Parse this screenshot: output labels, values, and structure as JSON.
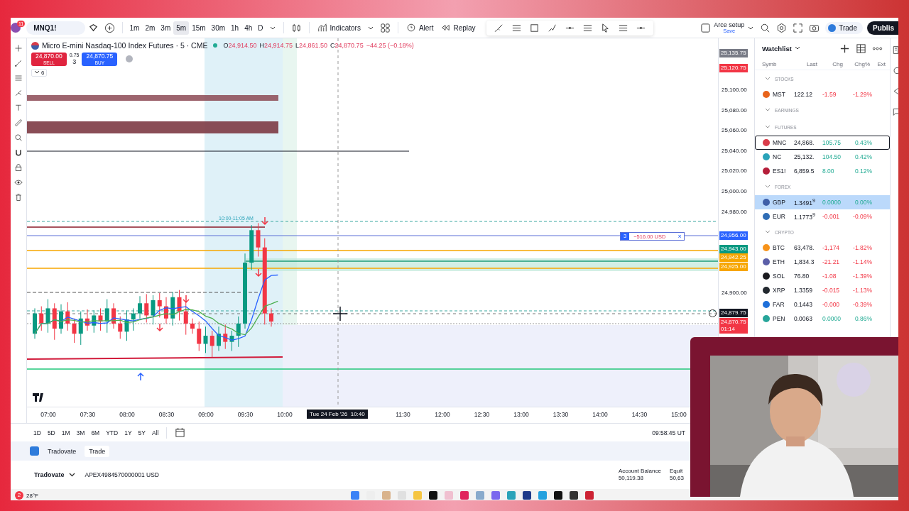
{
  "top_toolbar": {
    "notification_badge": "11",
    "symbol": "MNQ1!",
    "intervals": [
      {
        "label": "1m",
        "selected": false
      },
      {
        "label": "2m",
        "selected": false
      },
      {
        "label": "3m",
        "selected": false
      },
      {
        "label": "5m",
        "selected": true
      },
      {
        "label": "15m",
        "selected": false
      },
      {
        "label": "30m",
        "selected": false
      },
      {
        "label": "1h",
        "selected": false
      },
      {
        "label": "4h",
        "selected": false
      },
      {
        "label": "D",
        "selected": false
      }
    ],
    "indicators": "Indicators",
    "alert": "Alert",
    "replay": "Replay",
    "layout": {
      "name": "Arce setup",
      "status": "Save"
    },
    "trade": "Trade",
    "publish": "Publis"
  },
  "chart": {
    "title": "Micro E-mini Nasdaq-100 Index Futures · 5 · CME",
    "market_open": true,
    "ohlc": [
      {
        "label": "O",
        "value": "24,914.50"
      },
      {
        "label": "H",
        "value": "24,914.75"
      },
      {
        "label": "L",
        "value": "24,861.50"
      },
      {
        "label": "C",
        "value": "24,870.75"
      }
    ],
    "change": "−44.25 (−0.18%)",
    "sell": {
      "price": "24,870.00",
      "label": "SELL"
    },
    "spread": {
      "value": "0.75",
      "quantity": "3"
    },
    "buy": {
      "price": "24,870.75",
      "label": "BUY"
    },
    "indicators_count": "6",
    "session_label": "10:00-11:05 AM",
    "position": {
      "quantity": "3",
      "pnl": "−516.00 USD",
      "close": "×"
    },
    "price_axis": [
      {
        "kind": "badge",
        "text": "25,135.75",
        "color": "#787b86"
      },
      {
        "kind": "badge",
        "text": "25,120.75",
        "color": "#f23645"
      },
      {
        "kind": "tick",
        "text": "25,100.00"
      },
      {
        "kind": "tick",
        "text": "25,080.00"
      },
      {
        "kind": "tick",
        "text": "25,060.00"
      },
      {
        "kind": "tick",
        "text": "25,040.00"
      },
      {
        "kind": "tick",
        "text": "25,020.00"
      },
      {
        "kind": "tick",
        "text": "25,000.00"
      },
      {
        "kind": "tick",
        "text": "24,980.00"
      },
      {
        "kind": "badge",
        "text": "24,956.00",
        "color": "#2962ff"
      },
      {
        "kind": "badge",
        "text": "24,943.00",
        "color": "#089981"
      },
      {
        "kind": "badge",
        "text": "24,942.25",
        "color": "#f7a600"
      },
      {
        "kind": "badge",
        "text": "24,925.00",
        "color": "#f7a600"
      },
      {
        "kind": "tick",
        "text": "24,900.00"
      },
      {
        "kind": "badge",
        "text": "24,879.75",
        "color": "#131722"
      },
      {
        "kind": "badge",
        "text": "24,870.75",
        "color": "#f23645",
        "countdown": "01:14"
      }
    ],
    "time_axis": [
      "07:00",
      "07:30",
      "08:00",
      "08:30",
      "09:00",
      "09:30",
      "10:00",
      "11:30",
      "12:00",
      "12:30",
      "13:00",
      "13:30",
      "14:00",
      "14:30",
      "15:00"
    ],
    "cursor_time": "Tue 24 Feb '26  10:40"
  },
  "range_bar": {
    "ranges": [
      "1D",
      "5D",
      "1M",
      "3M",
      "6M",
      "YTD",
      "1Y",
      "5Y",
      "All"
    ],
    "clock": "09:58:45 UT"
  },
  "panel": {
    "tabs": [
      {
        "label": "Tradovate",
        "selected": false
      },
      {
        "label": "Trade",
        "selected": true
      }
    ],
    "account_broker": "Tradovate",
    "account": "APEX4984570000001 USD",
    "balance_label": "Account Balance",
    "balance": "50,119.38",
    "equity_label": "Equit",
    "equity": "50,63"
  },
  "watchlist": {
    "title": "Watchlist",
    "columns": [
      "Symb",
      "Last",
      "Chg",
      "Chg%",
      "Ext"
    ],
    "rows": [
      {
        "kind": "section",
        "label": "STOCKS"
      },
      {
        "kind": "symbol",
        "symbol": "MST",
        "last": "122.12",
        "chg": "-1.59",
        "pct": "-1.29%",
        "rising": false,
        "color": "#e8641b",
        "selected": false,
        "focused": false
      },
      {
        "kind": "section",
        "label": "EARNINGS"
      },
      {
        "kind": "section",
        "label": "FUTURES"
      },
      {
        "kind": "symbol",
        "symbol": "MNC",
        "last": "24,868.",
        "chg": "105.75",
        "pct": "0.43%",
        "rising": true,
        "color": "#d93c4a",
        "selected": false,
        "focused": true
      },
      {
        "kind": "symbol",
        "symbol": "NC",
        "last": "25,132.",
        "chg": "104.50",
        "pct": "0.42%",
        "rising": true,
        "color": "#2aa3b9",
        "selected": false,
        "focused": false
      },
      {
        "kind": "symbol",
        "symbol": "ES1!",
        "last": "6,859.5",
        "chg": "8.00",
        "pct": "0.12%",
        "rising": true,
        "color": "#b51e3a",
        "selected": false,
        "focused": false
      },
      {
        "kind": "section",
        "label": "FOREX"
      },
      {
        "kind": "symbol",
        "symbol": "GBP",
        "last": "1.3491$^{9}$",
        "chg": "0.0000",
        "pct": "0.00%",
        "rising": true,
        "color": "#3f5fa8",
        "selected": true,
        "focused": false
      },
      {
        "kind": "symbol",
        "symbol": "EUR",
        "last": "1.1773$^{9}$",
        "chg": "-0.001",
        "pct": "-0.09%",
        "rising": false,
        "color": "#2f6db5",
        "selected": false,
        "focused": false
      },
      {
        "kind": "section",
        "label": "CRYPTO"
      },
      {
        "kind": "symbol",
        "symbol": "BTC",
        "last": "63,478.",
        "chg": "-1,174",
        "pct": "-1.82%",
        "rising": false,
        "color": "#f7931a",
        "selected": false,
        "focused": false
      },
      {
        "kind": "symbol",
        "symbol": "ETH",
        "last": "1,834.3",
        "chg": "-21.21",
        "pct": "-1.14%",
        "rising": false,
        "color": "#5b5fa8",
        "selected": false,
        "focused": false
      },
      {
        "kind": "symbol",
        "symbol": "SOL",
        "last": "76.80",
        "chg": "-1.08",
        "pct": "-1.39%",
        "rising": false,
        "color": "#1b1b1f",
        "selected": false,
        "focused": false
      },
      {
        "kind": "symbol",
        "symbol": "XRP",
        "last": "1.3359",
        "chg": "-0.015",
        "pct": "-1.13%",
        "rising": false,
        "color": "#23292f",
        "selected": false,
        "focused": false
      },
      {
        "kind": "symbol",
        "symbol": "FAR",
        "last": "0.1443",
        "chg": "-0.000",
        "pct": "-0.39%",
        "rising": false,
        "color": "#1e6fd9",
        "selected": false,
        "focused": false
      },
      {
        "kind": "symbol",
        "symbol": "PEN",
        "last": "0.0063",
        "chg": "0.0000",
        "pct": "0.86%",
        "rising": true,
        "color": "#27a59a",
        "selected": false,
        "focused": false
      }
    ]
  },
  "taskbar": {
    "weather_badge": "2",
    "weather": "28°F"
  }
}
